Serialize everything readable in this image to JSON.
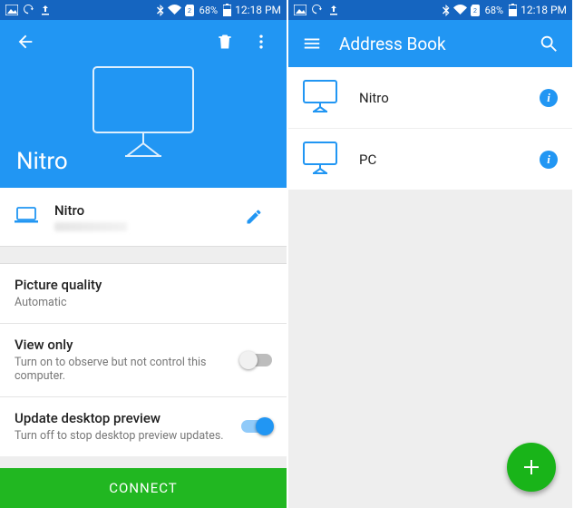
{
  "status": {
    "battery_pct": "68%",
    "time": "12:18 PM"
  },
  "left": {
    "hero_title": "Nitro",
    "device_name": "Nitro",
    "settings": {
      "picture_quality": {
        "title": "Picture quality",
        "value": "Automatic"
      },
      "view_only": {
        "title": "View only",
        "sub": "Turn on to observe but not control this computer.",
        "on": false
      },
      "update_preview": {
        "title": "Update desktop preview",
        "sub": "Turn off to stop desktop preview updates.",
        "on": true
      }
    },
    "connect_label": "CONNECT"
  },
  "right": {
    "title": "Address Book",
    "items": [
      {
        "label": "Nitro"
      },
      {
        "label": "PC"
      }
    ]
  }
}
